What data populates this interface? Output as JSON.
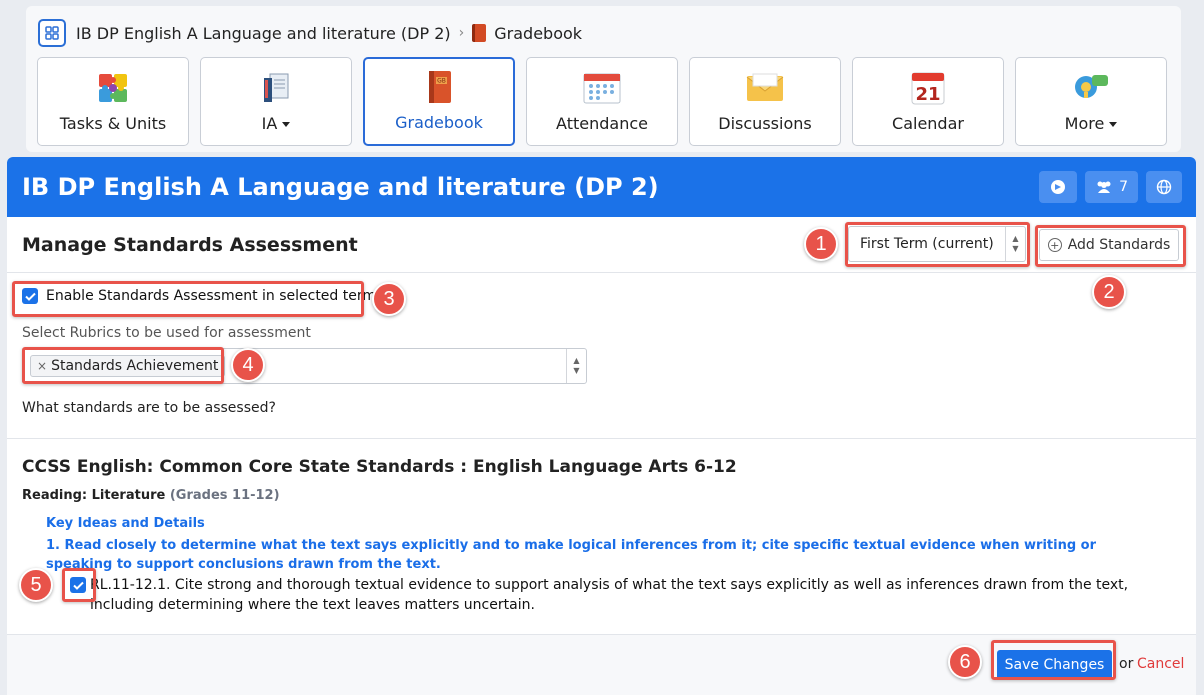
{
  "breadcrumb": {
    "course": "IB DP English A Language and literature (DP 2)",
    "separator": "›",
    "current": "Gradebook"
  },
  "tiles": [
    {
      "label": "Tasks & Units",
      "icon": "puzzle-icon",
      "caret": false,
      "active": false
    },
    {
      "label": "IA",
      "icon": "ia-documents-icon",
      "caret": true,
      "active": false
    },
    {
      "label": "Gradebook",
      "icon": "gradebook-icon",
      "caret": false,
      "active": true
    },
    {
      "label": "Attendance",
      "icon": "attendance-icon",
      "caret": false,
      "active": false
    },
    {
      "label": "Discussions",
      "icon": "envelope-icon",
      "caret": false,
      "active": false
    },
    {
      "label": "Calendar",
      "icon": "calendar-icon",
      "caret": false,
      "active": false
    },
    {
      "label": "More",
      "icon": "more-bubbles-icon",
      "caret": true,
      "active": false
    }
  ],
  "calendar_day": "21",
  "panel": {
    "title": "IB DP English A Language and literature (DP 2)",
    "members_count": "7",
    "section_title": "Manage Standards Assessment",
    "term_select": "First Term (current)",
    "add_standards": "Add Standards",
    "enable_label": "Enable Standards Assessment in selected term",
    "rubrics_label": "Select Rubrics to be used for assessment",
    "rubric_tag": "Standards Achievement",
    "rubric_remove": "×",
    "what_label": "What standards are to be assessed?"
  },
  "standards": {
    "title": "CCSS English: Common Core State Standards : English Language Arts 6-12",
    "strand": "Reading: Literature",
    "grades": "(Grades 11-12)",
    "cluster": "Key Ideas and Details",
    "anchor": "1. Read closely to determine what the text says explicitly and to make logical inferences from it; cite specific textual evidence when writing or speaking to support conclusions drawn from the text.",
    "item": "RL.11-12.1. Cite strong and thorough textual evidence to support analysis of what the text says explicitly as well as inferences drawn from the text, including determining where the text leaves matters uncertain."
  },
  "footer": {
    "save": "Save Changes",
    "or": "or",
    "cancel": "Cancel"
  },
  "callouts": [
    "1",
    "2",
    "3",
    "4",
    "5",
    "6"
  ],
  "colors": {
    "primary": "#1b72e8",
    "callout": "#e8534a",
    "cancel": "#e03b3b",
    "link_blue": "#1a6ee8"
  }
}
